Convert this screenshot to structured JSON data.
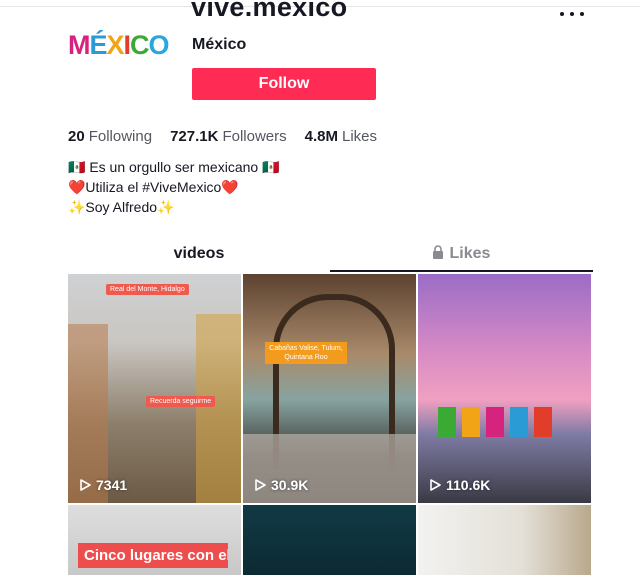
{
  "profile": {
    "username": "vive.mexico",
    "nickname": "México",
    "avatar_text": [
      "M",
      "É",
      "X",
      "I",
      "C",
      "O"
    ],
    "avatar_colors": [
      "#d6247e",
      "#2b9bd6",
      "#f2a417",
      "#e23c2a",
      "#3aaa35",
      "#28a6e0"
    ],
    "follow_label": "Follow"
  },
  "stats": [
    {
      "value": "20",
      "label": "Following"
    },
    {
      "value": "727.1K",
      "label": "Followers"
    },
    {
      "value": "4.8M",
      "label": "Likes"
    }
  ],
  "bio": [
    "🇲🇽 Es un orgullo ser mexicano 🇲🇽",
    "❤️Utiliza el #ViveMexico❤️",
    "✨Soy Alfredo✨"
  ],
  "tabs": {
    "videos": "videos",
    "likes": "Likes"
  },
  "videos": [
    {
      "views": "7341",
      "tags": [
        "Real del Monte, Hidalgo",
        "Recuerda seguirme"
      ]
    },
    {
      "views": "30.9K",
      "tags": [
        "Cabañas Valise, Tulum, Quintana Roo"
      ]
    },
    {
      "views": "110.6K",
      "tags": []
    },
    {
      "views": "",
      "caption": "Cinco lugares con el clima más bonito de"
    },
    {
      "views": ""
    },
    {
      "views": ""
    }
  ],
  "colors": {
    "accent": "#fe2c55",
    "text": "#161823",
    "muted": "#545660"
  },
  "icons": {
    "more": "more-icon",
    "lock": "lock-icon",
    "play": "play-icon"
  }
}
